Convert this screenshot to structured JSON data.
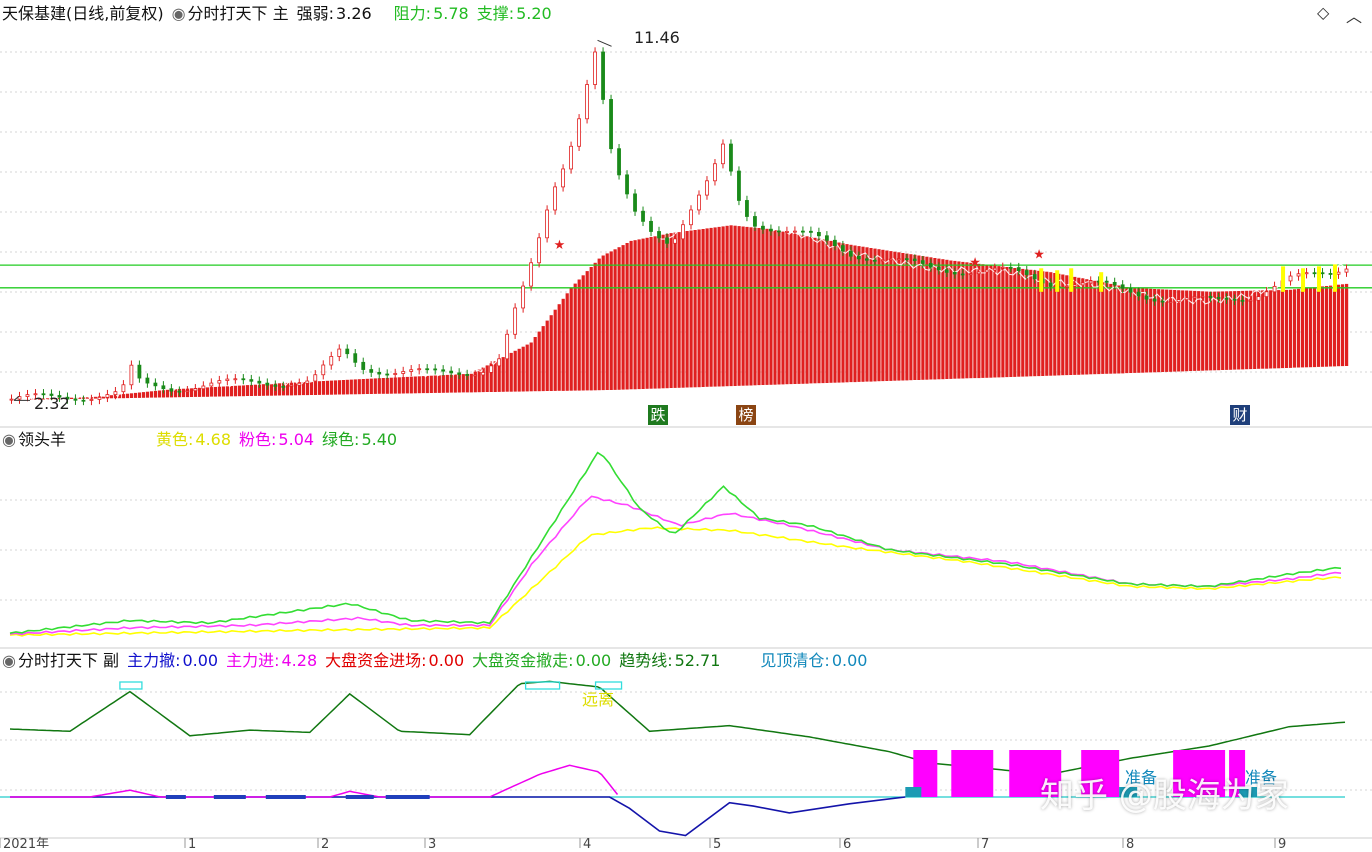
{
  "main_panel": {
    "stock": "天保基建(日线,前复权)",
    "indicator": "分时打天下 主",
    "strength_label": "强弱:",
    "strength_value": "3.26",
    "resistance_label": "阻力:",
    "resistance_value": "5.78",
    "support_label": "支撑:",
    "support_value": "5.20",
    "high_label": "11.46",
    "low_label": "2.32",
    "tags": [
      {
        "text": "跌",
        "color": "#1f7a1f"
      },
      {
        "text": "榜",
        "color": "#8b4513"
      },
      {
        "text": "财",
        "color": "#1f3f7a"
      }
    ],
    "colors": {
      "up": "#e02020",
      "down": "#1a8a1a",
      "line": "#22cc22",
      "signal": "#ffff00"
    }
  },
  "mid_panel": {
    "name": "领头羊",
    "yellow_label": "黄色:",
    "yellow_value": "4.68",
    "pink_label": "粉色:",
    "pink_value": "5.04",
    "green_label": "绿色:",
    "green_value": "5.40"
  },
  "sub_panel": {
    "name": "分时打天下 副",
    "items": [
      {
        "label": "主力撤:",
        "value": "0.00",
        "color": "#1010cc"
      },
      {
        "label": "主力进:",
        "value": "4.28",
        "color": "#ee00ee"
      },
      {
        "label": "大盘资金进场:",
        "value": "0.00",
        "color": "#e00000"
      },
      {
        "label": "大盘资金撤走:",
        "value": "0.00",
        "color": "#22aa22"
      },
      {
        "label": "趋势线:",
        "value": "52.71",
        "color": "#117711"
      },
      {
        "label": "见顶清仓:",
        "value": "0.00",
        "color": "#1188bb"
      }
    ],
    "annotations": {
      "far": "远离",
      "ready1": "准备",
      "ready2": "准备"
    }
  },
  "watermark": "知乎 @股海为家",
  "xaxis_labels": [
    "2021年",
    "1",
    "2",
    "3",
    "4",
    "5",
    "6",
    "7",
    "8",
    "9"
  ],
  "chart_data": [
    {
      "type": "candlestick",
      "title": "天保基建(日线,前复权)",
      "ylim": [
        2.2,
        11.8
      ],
      "annotations": {
        "max": 11.46,
        "min": 2.32,
        "resistance": 5.78,
        "support": 5.2
      },
      "close_path": [
        [
          0,
          2.35
        ],
        [
          20,
          2.38
        ],
        [
          40,
          2.45
        ],
        [
          55,
          2.5
        ],
        [
          60,
          3.1
        ],
        [
          65,
          2.7
        ],
        [
          80,
          2.65
        ],
        [
          100,
          2.72
        ],
        [
          125,
          2.8
        ],
        [
          150,
          2.78
        ],
        [
          165,
          3.6
        ],
        [
          175,
          3.2
        ],
        [
          190,
          3.05
        ],
        [
          210,
          3.0
        ],
        [
          235,
          3.1
        ],
        [
          245,
          3.4
        ],
        [
          250,
          4.3
        ],
        [
          258,
          5.4
        ],
        [
          265,
          6.6
        ],
        [
          270,
          7.6
        ],
        [
          278,
          8.6
        ],
        [
          285,
          9.8
        ],
        [
          290,
          10.9
        ],
        [
          293,
          11.4
        ],
        [
          298,
          9.0
        ],
        [
          305,
          7.8
        ],
        [
          312,
          7.1
        ],
        [
          320,
          6.7
        ],
        [
          330,
          6.4
        ],
        [
          340,
          7.2
        ],
        [
          350,
          8.0
        ],
        [
          357,
          8.9
        ],
        [
          362,
          7.6
        ],
        [
          370,
          6.9
        ],
        [
          385,
          6.7
        ],
        [
          400,
          6.5
        ],
        [
          420,
          6.1
        ],
        [
          440,
          5.9
        ],
        [
          460,
          5.7
        ],
        [
          480,
          5.65
        ],
        [
          500,
          5.6
        ],
        [
          520,
          5.35
        ],
        [
          540,
          5.3
        ],
        [
          560,
          5.1
        ],
        [
          580,
          4.9
        ],
        [
          600,
          4.85
        ],
        [
          620,
          5.0
        ],
        [
          640,
          5.4
        ],
        [
          660,
          5.6
        ],
        [
          668,
          5.8
        ]
      ],
      "bars_path": [
        [
          0,
          2.35
        ],
        [
          40,
          2.4
        ],
        [
          80,
          2.6
        ],
        [
          150,
          2.8
        ],
        [
          230,
          3.0
        ],
        [
          260,
          3.8
        ],
        [
          280,
          5.2
        ],
        [
          295,
          6.0
        ],
        [
          310,
          6.4
        ],
        [
          330,
          6.6
        ],
        [
          360,
          6.8
        ],
        [
          380,
          6.7
        ],
        [
          420,
          6.3
        ],
        [
          470,
          5.9
        ],
        [
          520,
          5.6
        ],
        [
          560,
          5.2
        ],
        [
          600,
          5.1
        ],
        [
          640,
          5.15
        ],
        [
          668,
          5.3
        ]
      ]
    },
    {
      "type": "line",
      "title": "领头羊",
      "series": [
        {
          "name": "黄色",
          "color": "#ffff00",
          "values": [
            [
              0,
              4.3
            ],
            [
              150,
              4.4
            ],
            [
              240,
              4.45
            ],
            [
              265,
              5.4
            ],
            [
              290,
              6.35
            ],
            [
              320,
              6.5
            ],
            [
              360,
              6.45
            ],
            [
              420,
              6.1
            ],
            [
              480,
              5.8
            ],
            [
              520,
              5.55
            ],
            [
              560,
              5.3
            ],
            [
              600,
              5.25
            ],
            [
              640,
              5.4
            ],
            [
              668,
              5.5
            ]
          ]
        },
        {
          "name": "粉色",
          "color": "#ff44ff",
          "values": [
            [
              0,
              4.32
            ],
            [
              60,
              4.45
            ],
            [
              120,
              4.5
            ],
            [
              175,
              4.65
            ],
            [
              200,
              4.5
            ],
            [
              240,
              4.5
            ],
            [
              262,
              5.8
            ],
            [
              290,
              7.15
            ],
            [
              310,
              6.95
            ],
            [
              335,
              6.55
            ],
            [
              360,
              6.8
            ],
            [
              390,
              6.55
            ],
            [
              440,
              6.05
            ],
            [
              500,
              5.8
            ],
            [
              560,
              5.35
            ],
            [
              600,
              5.3
            ],
            [
              640,
              5.45
            ],
            [
              668,
              5.6
            ]
          ]
        },
        {
          "name": "绿色",
          "color": "#33dd33",
          "values": [
            [
              0,
              4.34
            ],
            [
              60,
              4.6
            ],
            [
              100,
              4.55
            ],
            [
              170,
              4.95
            ],
            [
              200,
              4.6
            ],
            [
              240,
              4.55
            ],
            [
              275,
              6.8
            ],
            [
              295,
              8.1
            ],
            [
              315,
              6.9
            ],
            [
              332,
              6.35
            ],
            [
              357,
              7.35
            ],
            [
              375,
              6.7
            ],
            [
              400,
              6.55
            ],
            [
              440,
              6.05
            ],
            [
              500,
              5.75
            ],
            [
              560,
              5.35
            ],
            [
              600,
              5.3
            ],
            [
              640,
              5.55
            ],
            [
              668,
              5.7
            ]
          ]
        }
      ]
    },
    {
      "type": "line",
      "title": "分时打天下 副",
      "series": [
        {
          "name": "趋势线",
          "color": "#117711",
          "values": [
            [
              0,
              60
            ],
            [
              30,
              58
            ],
            [
              60,
              93
            ],
            [
              90,
              54
            ],
            [
              120,
              59
            ],
            [
              150,
              57
            ],
            [
              170,
              91
            ],
            [
              195,
              58
            ],
            [
              230,
              55
            ],
            [
              255,
              100
            ],
            [
              270,
              102
            ],
            [
              295,
              97
            ],
            [
              320,
              58
            ],
            [
              360,
              63
            ],
            [
              400,
              53
            ],
            [
              440,
              40
            ],
            [
              460,
              30
            ],
            [
              520,
              20
            ],
            [
              560,
              34
            ],
            [
              600,
              45
            ],
            [
              640,
              62
            ],
            [
              668,
              66
            ]
          ]
        },
        {
          "name": "主力进",
          "color": "#ee00ee",
          "values": [
            [
              0,
              0
            ],
            [
              40,
              0
            ],
            [
              60,
              6
            ],
            [
              75,
              0
            ],
            [
              160,
              0
            ],
            [
              170,
              5
            ],
            [
              185,
              0
            ],
            [
              240,
              0
            ],
            [
              265,
              20
            ],
            [
              280,
              28
            ],
            [
              295,
              22
            ],
            [
              305,
              0
            ]
          ]
        }
      ]
    }
  ]
}
